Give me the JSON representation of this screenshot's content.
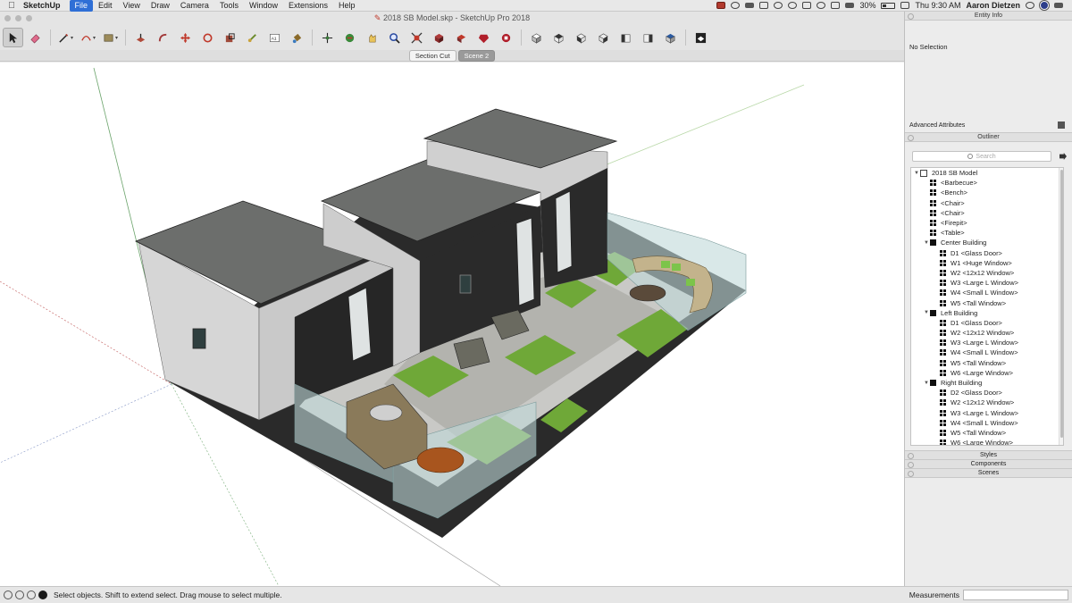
{
  "menubar": {
    "apple": "",
    "app_name": "SketchUp",
    "items": [
      "File",
      "Edit",
      "View",
      "Draw",
      "Camera",
      "Tools",
      "Window",
      "Extensions",
      "Help"
    ],
    "active_item": "File",
    "battery_pct": "30%",
    "clock": "Thu 9:30 AM",
    "user": "Aaron Dietzen"
  },
  "window": {
    "title": "2018 SB Model.skp - SketchUp Pro 2018"
  },
  "toolbar": {
    "tools": [
      "select-icon",
      "eraser-icon",
      "line-icon",
      "arc-icon",
      "shapes-icon",
      "push-pull-icon",
      "follow-me-icon",
      "move-icon",
      "rotate-icon",
      "scale-icon",
      "offset-icon",
      "tape-measure-icon",
      "text-icon",
      "paint-bucket-icon",
      "orbit-icon",
      "pan-icon",
      "zoom-icon",
      "zoom-extents-icon",
      "previous-view-icon",
      "next-view-icon",
      "warehouse-icon",
      "iso-view-icon",
      "top-view-icon",
      "front-view-icon",
      "right-view-icon",
      "back-view-icon",
      "left-view-icon",
      "bottom-view-icon",
      "xray-icon"
    ]
  },
  "scenes": {
    "tabs": [
      "Section Cut",
      "Scene 2"
    ],
    "active": "Scene 2"
  },
  "entity_info": {
    "title": "Entity Info",
    "status": "No Selection",
    "advanced": "Advanced Attributes"
  },
  "outliner": {
    "title": "Outliner",
    "search_placeholder": "Search",
    "rows": [
      {
        "depth": 0,
        "expand": "▼",
        "icon": "model",
        "label": "2018 SB Model"
      },
      {
        "depth": 1,
        "expand": "",
        "icon": "comp",
        "label": "<Barbecue>"
      },
      {
        "depth": 1,
        "expand": "",
        "icon": "comp",
        "label": "<Bench>"
      },
      {
        "depth": 1,
        "expand": "",
        "icon": "comp",
        "label": "<Chair>"
      },
      {
        "depth": 1,
        "expand": "",
        "icon": "comp",
        "label": "<Chair>"
      },
      {
        "depth": 1,
        "expand": "",
        "icon": "comp",
        "label": "<Firepit>"
      },
      {
        "depth": 1,
        "expand": "",
        "icon": "comp",
        "label": "<Table>"
      },
      {
        "depth": 1,
        "expand": "▼",
        "icon": "group",
        "label": "Center Building"
      },
      {
        "depth": 2,
        "expand": "",
        "icon": "comp",
        "label": "D1 <Glass Door>"
      },
      {
        "depth": 2,
        "expand": "",
        "icon": "comp",
        "label": "W1 <Huge Window>"
      },
      {
        "depth": 2,
        "expand": "",
        "icon": "comp",
        "label": "W2 <12x12 Window>"
      },
      {
        "depth": 2,
        "expand": "",
        "icon": "comp",
        "label": "W3 <Large L Window>"
      },
      {
        "depth": 2,
        "expand": "",
        "icon": "comp",
        "label": "W4 <Small L Window>"
      },
      {
        "depth": 2,
        "expand": "",
        "icon": "comp",
        "label": "W5 <Tall Window>"
      },
      {
        "depth": 1,
        "expand": "▼",
        "icon": "group",
        "label": "Left Building"
      },
      {
        "depth": 2,
        "expand": "",
        "icon": "comp",
        "label": "D1 <Glass Door>"
      },
      {
        "depth": 2,
        "expand": "",
        "icon": "comp",
        "label": "W2 <12x12 Window>"
      },
      {
        "depth": 2,
        "expand": "",
        "icon": "comp",
        "label": "W3 <Large L Window>"
      },
      {
        "depth": 2,
        "expand": "",
        "icon": "comp",
        "label": "W4 <Small L Window>"
      },
      {
        "depth": 2,
        "expand": "",
        "icon": "comp",
        "label": "W5 <Tall Window>"
      },
      {
        "depth": 2,
        "expand": "",
        "icon": "comp",
        "label": "W6 <Large Window>"
      },
      {
        "depth": 1,
        "expand": "▼",
        "icon": "group",
        "label": "Right Building"
      },
      {
        "depth": 2,
        "expand": "",
        "icon": "comp",
        "label": "D2 <Glass Door>"
      },
      {
        "depth": 2,
        "expand": "",
        "icon": "comp",
        "label": "W2 <12x12 Window>"
      },
      {
        "depth": 2,
        "expand": "",
        "icon": "comp",
        "label": "W3 <Large L Window>"
      },
      {
        "depth": 2,
        "expand": "",
        "icon": "comp",
        "label": "W4 <Small L Window>"
      },
      {
        "depth": 2,
        "expand": "",
        "icon": "comp",
        "label": "W5 <Tall Window>"
      },
      {
        "depth": 2,
        "expand": "",
        "icon": "comp",
        "label": "W6 <Large Window>"
      }
    ]
  },
  "tray_panels": [
    "Styles",
    "Components",
    "Scenes"
  ],
  "status": {
    "message": "Select objects. Shift to extend select. Drag mouse to select multiple.",
    "measurements_label": "Measurements"
  }
}
